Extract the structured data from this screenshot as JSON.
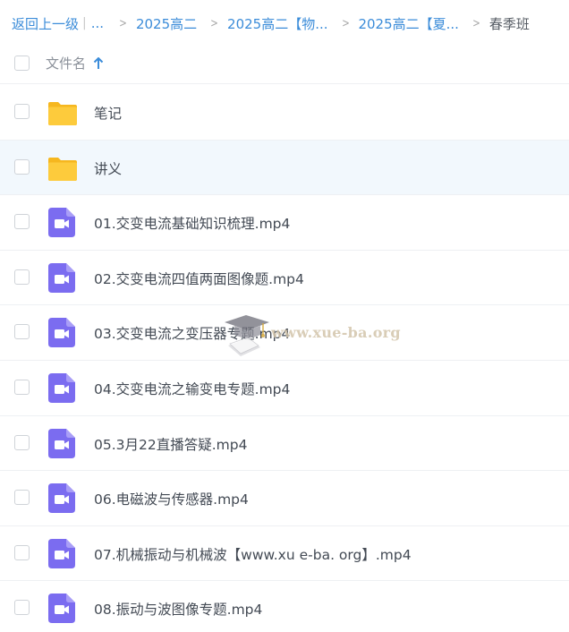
{
  "breadcrumb": {
    "back_label": "返回上一级",
    "ellipsis": "...",
    "crumbs": [
      "2025高二",
      "2025高二【物...",
      "2025高二【夏..."
    ],
    "current": "春季班"
  },
  "header": {
    "column_name": "文件名",
    "sort": "ascending"
  },
  "files": [
    {
      "name": "笔记",
      "type": "folder"
    },
    {
      "name": "讲义",
      "type": "folder"
    },
    {
      "name": "01.交变电流基础知识梳理.mp4",
      "type": "video"
    },
    {
      "name": "02.交变电流四值两面图像题.mp4",
      "type": "video"
    },
    {
      "name": "03.交变电流之变压器专题.mp4",
      "type": "video"
    },
    {
      "name": "04.交变电流之输变电专题.mp4",
      "type": "video"
    },
    {
      "name": "05.3月22直播答疑.mp4",
      "type": "video"
    },
    {
      "name": "06.电磁波与传感器.mp4",
      "type": "video"
    },
    {
      "name": "07.机械振动与机械波【www.xu e-ba. org】.mp4",
      "type": "video"
    },
    {
      "name": "08.振动与波图像专题.mp4",
      "type": "video"
    }
  ],
  "icons": {
    "folder": "folder-icon",
    "video": "video-file-icon",
    "sort": "arrow-up-icon"
  },
  "colors": {
    "link": "#3b8cd9",
    "folder": "#fdc634",
    "video": "#7b6cf0",
    "row_hover": "#f2f8fd"
  },
  "watermark": {
    "text": "www.xue-ba.org"
  }
}
